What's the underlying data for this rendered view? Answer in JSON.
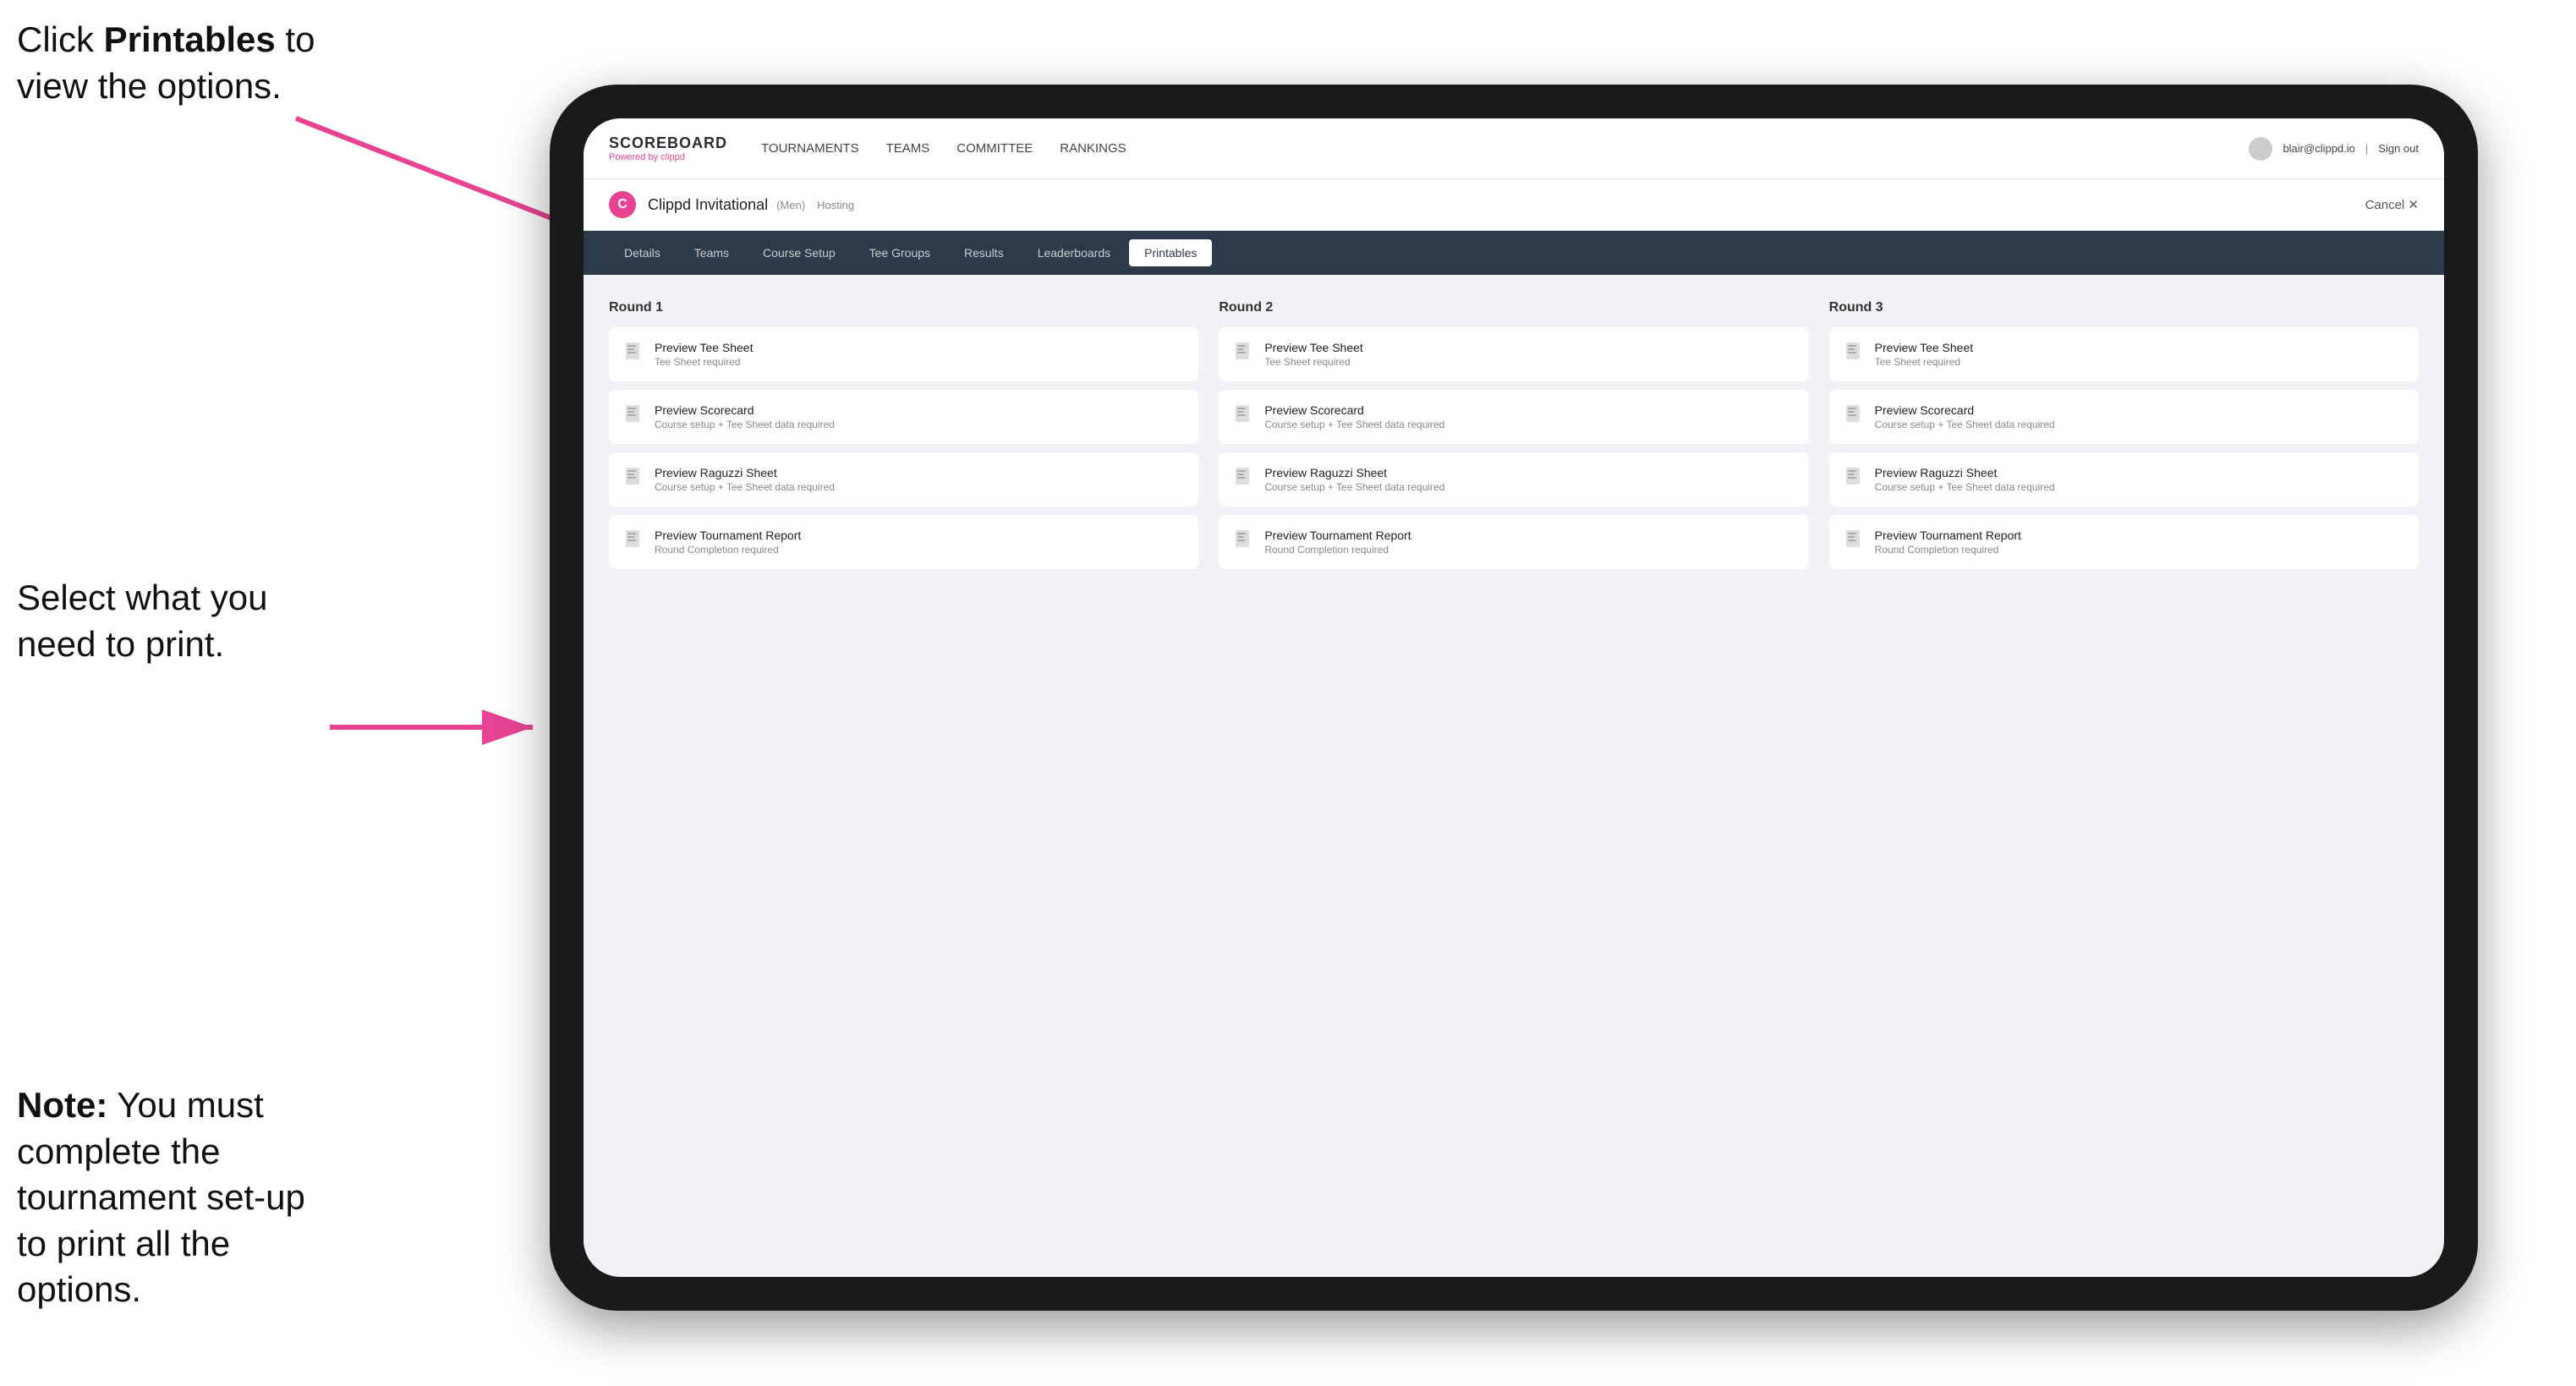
{
  "instructions": {
    "top": "Click ",
    "top_bold": "Printables",
    "top_rest": " to view the options.",
    "middle": "Select what you need to print.",
    "bottom_bold": "Note:",
    "bottom_rest": " You must complete the tournament set-up to print all the options."
  },
  "topnav": {
    "logo_title": "SCOREBOARD",
    "logo_sub": "Powered by clippd",
    "links": [
      "TOURNAMENTS",
      "TEAMS",
      "COMMITTEE",
      "RANKINGS"
    ],
    "user": "blair@clippd.io",
    "signout": "Sign out"
  },
  "tournament": {
    "logo_letter": "C",
    "name": "Clippd Invitational",
    "badge": "(Men)",
    "status": "Hosting",
    "cancel": "Cancel ✕"
  },
  "subnav": {
    "tabs": [
      "Details",
      "Teams",
      "Course Setup",
      "Tee Groups",
      "Results",
      "Leaderboards",
      "Printables"
    ],
    "active": "Printables"
  },
  "rounds": [
    {
      "title": "Round 1",
      "cards": [
        {
          "title": "Preview Tee Sheet",
          "subtitle": "Tee Sheet required"
        },
        {
          "title": "Preview Scorecard",
          "subtitle": "Course setup + Tee Sheet data required"
        },
        {
          "title": "Preview Raguzzi Sheet",
          "subtitle": "Course setup + Tee Sheet data required"
        },
        {
          "title": "Preview Tournament Report",
          "subtitle": "Round Completion required"
        }
      ]
    },
    {
      "title": "Round 2",
      "cards": [
        {
          "title": "Preview Tee Sheet",
          "subtitle": "Tee Sheet required"
        },
        {
          "title": "Preview Scorecard",
          "subtitle": "Course setup + Tee Sheet data required"
        },
        {
          "title": "Preview Raguzzi Sheet",
          "subtitle": "Course setup + Tee Sheet data required"
        },
        {
          "title": "Preview Tournament Report",
          "subtitle": "Round Completion required"
        }
      ]
    },
    {
      "title": "Round 3",
      "cards": [
        {
          "title": "Preview Tee Sheet",
          "subtitle": "Tee Sheet required"
        },
        {
          "title": "Preview Scorecard",
          "subtitle": "Course setup + Tee Sheet data required"
        },
        {
          "title": "Preview Raguzzi Sheet",
          "subtitle": "Course setup + Tee Sheet data required"
        },
        {
          "title": "Preview Tournament Report",
          "subtitle": "Round Completion required"
        }
      ]
    }
  ],
  "colors": {
    "pink": "#e84393",
    "nav_bg": "#2d3a4a"
  }
}
